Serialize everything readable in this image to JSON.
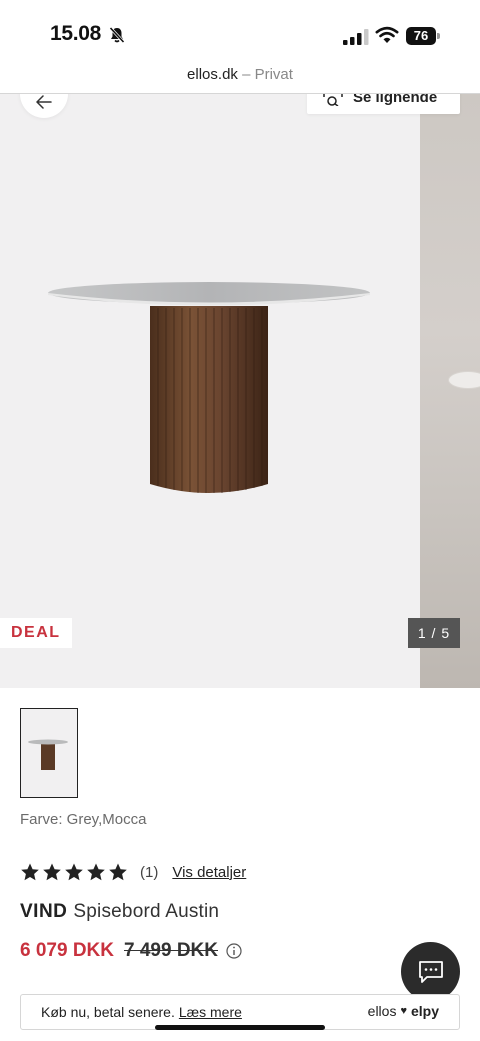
{
  "status_bar": {
    "time": "15.08",
    "battery": "76"
  },
  "browser": {
    "domain": "ellos.dk",
    "separator": " – ",
    "mode": "Privat"
  },
  "gallery": {
    "similar_label": "Se lignende",
    "deal_label": "DEAL",
    "counter": "1 / 5"
  },
  "product": {
    "colour_label": "Farve: Grey,Mocca",
    "rating": {
      "stars": 5,
      "max": 5,
      "count": "(1)",
      "details_label": "Vis detaljer"
    },
    "brand": "VIND",
    "name": "Spisebord Austin",
    "price_now": "6 079 DKK",
    "price_old": "7 499 DKK"
  },
  "payment_banner": {
    "text": "Køb nu, betal senere.",
    "link": "Læs mere",
    "logo_left": "ellos",
    "logo_right": "elpy"
  },
  "colors": {
    "accent_red": "#c8323e",
    "dark": "#2b2b2b",
    "gallery_bg": "#f1f0f1"
  },
  "icons": [
    "bell-off-icon",
    "signal-icon",
    "wifi-icon",
    "battery-icon",
    "back-arrow-icon",
    "visual-search-icon",
    "star-icon",
    "info-icon",
    "chat-icon",
    "heart-icon"
  ]
}
